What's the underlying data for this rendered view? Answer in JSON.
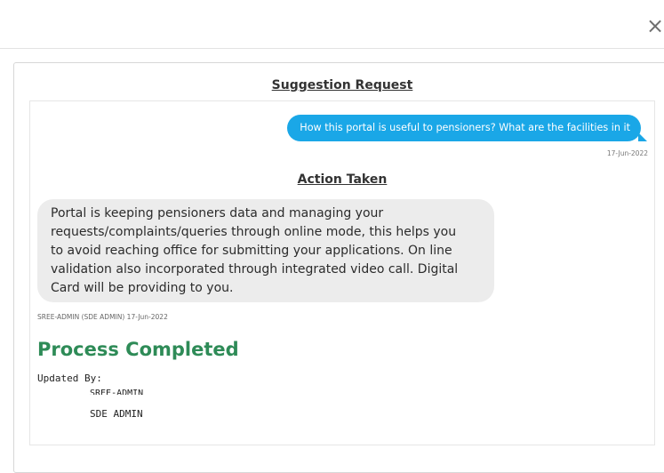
{
  "dialog": {
    "close_label": "×"
  },
  "suggestion": {
    "title": "Suggestion Request",
    "message": "How this portal is useful to pensioners? What are the facilities in it",
    "date": "17-Jun-2022"
  },
  "action": {
    "title": "Action Taken",
    "reply": "Portal is keeping pensioners data and managing your requests/complaints/queries through online mode, this helps you to avoid reaching office for submitting your applications. On line validation also incorporated through integrated video call. Digital Card will be providing to you.",
    "meta": "SREE-ADMIN (SDE ADMIN) 17-Jun-2022",
    "status": "Process Completed",
    "updated_by_label": "Updated By:",
    "updated_by_user": "SREE-ADMIN",
    "updated_by_name": "SDE ADMIN"
  }
}
